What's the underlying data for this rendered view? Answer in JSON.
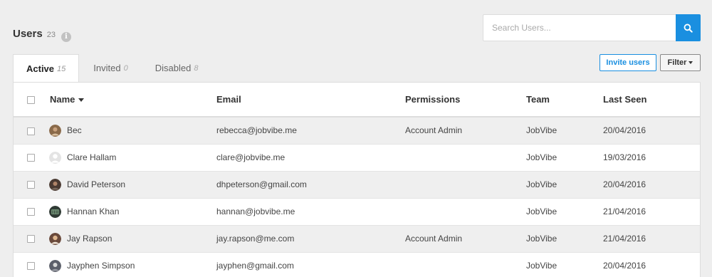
{
  "header": {
    "title": "Users",
    "count": "23",
    "info_icon": "info-icon"
  },
  "search": {
    "placeholder": "Search Users...",
    "value": "",
    "icon": "search-icon",
    "accent": "#1a8fe0"
  },
  "tabs": [
    {
      "label": "Active",
      "count": "15",
      "active": true
    },
    {
      "label": "Invited",
      "count": "0",
      "active": false
    },
    {
      "label": "Disabled",
      "count": "8",
      "active": false
    }
  ],
  "actions": {
    "invite_label": "Invite users",
    "filter_label": "Filter"
  },
  "table": {
    "columns": [
      "Name",
      "Email",
      "Permissions",
      "Team",
      "Last Seen"
    ],
    "rows": [
      {
        "name": "Bec",
        "email": "rebecca@jobvibe.me",
        "permissions": "Account Admin",
        "team": "JobVibe",
        "last_seen": "20/04/2016",
        "avatar_color": "#8a6a4a"
      },
      {
        "name": "Clare Hallam",
        "email": "clare@jobvibe.me",
        "permissions": "",
        "team": "JobVibe",
        "last_seen": "19/03/2016",
        "avatar_color": "#e4e4e4"
      },
      {
        "name": "David Peterson",
        "email": "dhpeterson@gmail.com",
        "permissions": "",
        "team": "JobVibe",
        "last_seen": "20/04/2016",
        "avatar_color": "#4a3a32"
      },
      {
        "name": "Hannan Khan",
        "email": "hannan@jobvibe.me",
        "permissions": "",
        "team": "JobVibe",
        "last_seen": "21/04/2016",
        "avatar_color": "#2f3a34"
      },
      {
        "name": "Jay Rapson",
        "email": "jay.rapson@me.com",
        "permissions": "Account Admin",
        "team": "JobVibe",
        "last_seen": "21/04/2016",
        "avatar_color": "#6a4a3c"
      },
      {
        "name": "Jayphen Simpson",
        "email": "jayphen@gmail.com",
        "permissions": "",
        "team": "JobVibe",
        "last_seen": "20/04/2016",
        "avatar_color": "#5c5f6a"
      }
    ]
  }
}
